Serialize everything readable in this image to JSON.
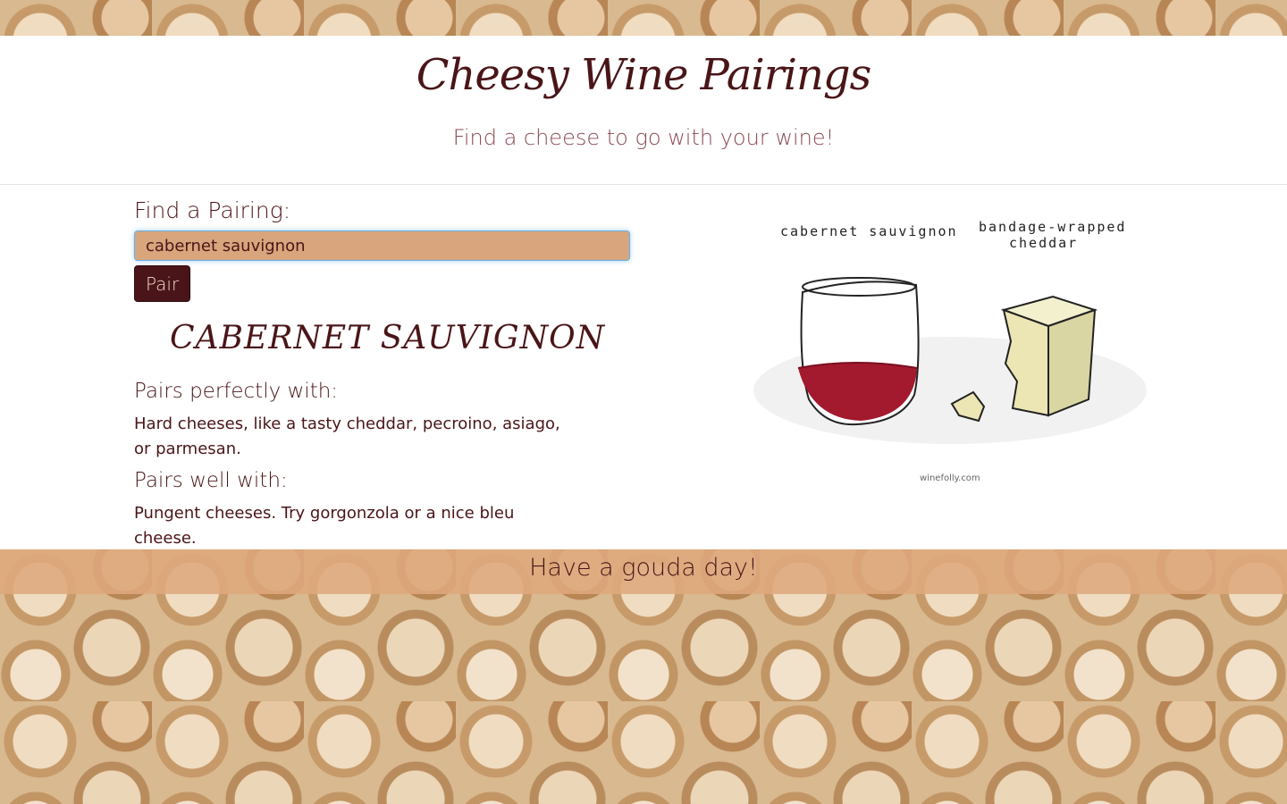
{
  "header": {
    "title": "Cheesy Wine Pairings",
    "subtitle": "Find a cheese to go with your wine!"
  },
  "search": {
    "label": "Find a Pairing:",
    "value": "cabernet sauvignon",
    "button_label": "Pair"
  },
  "result": {
    "wine_name": "CABERNET SAUVIGNON",
    "perfect_heading": "Pairs perfectly with:",
    "perfect_text": "Hard cheeses, like a tasty cheddar, pecroino, asiago, or parmesan.",
    "well_heading": "Pairs well with:",
    "well_text": "Pungent cheeses. Try gorgonzola or a nice bleu cheese."
  },
  "illustration": {
    "wine_label": "cabernet sauvignon",
    "cheese_label_line1": "bandage-wrapped",
    "cheese_label_line2": "cheddar",
    "credit": "winefolly.com"
  },
  "footer": {
    "text": "Have a gouda day!"
  },
  "colors": {
    "brand": "#4a1518",
    "subtitle": "#8a4a55",
    "input_bg": "#d8a57c",
    "footer_band": "#dea87d"
  }
}
